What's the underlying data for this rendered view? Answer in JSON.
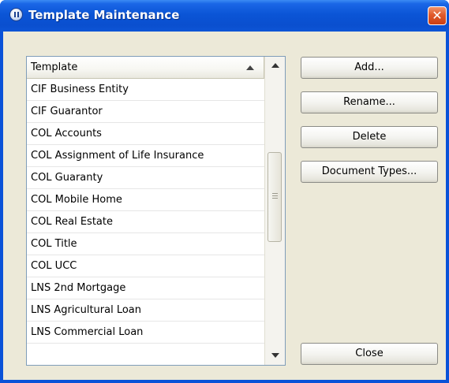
{
  "window": {
    "title": "Template Maintenance",
    "close_glyph": "✕",
    "icon": "app-pause-icon"
  },
  "list": {
    "header": "Template",
    "items": [
      "CIF Business Entity",
      "CIF Guarantor",
      "COL Accounts",
      "COL Assignment of Life Insurance",
      "COL Guaranty",
      "COL Mobile Home",
      "COL Real Estate",
      "COL Title",
      "COL UCC",
      "LNS 2nd Mortgage",
      "LNS Agricultural Loan",
      "LNS Commercial Loan"
    ]
  },
  "buttons": {
    "add": "Add...",
    "rename": "Rename...",
    "delete": "Delete",
    "document_types": "Document Types...",
    "close": "Close"
  },
  "colors": {
    "titlebar": "#0b55d6",
    "client_bg": "#ece9d8",
    "close_button": "#e05a2b"
  }
}
